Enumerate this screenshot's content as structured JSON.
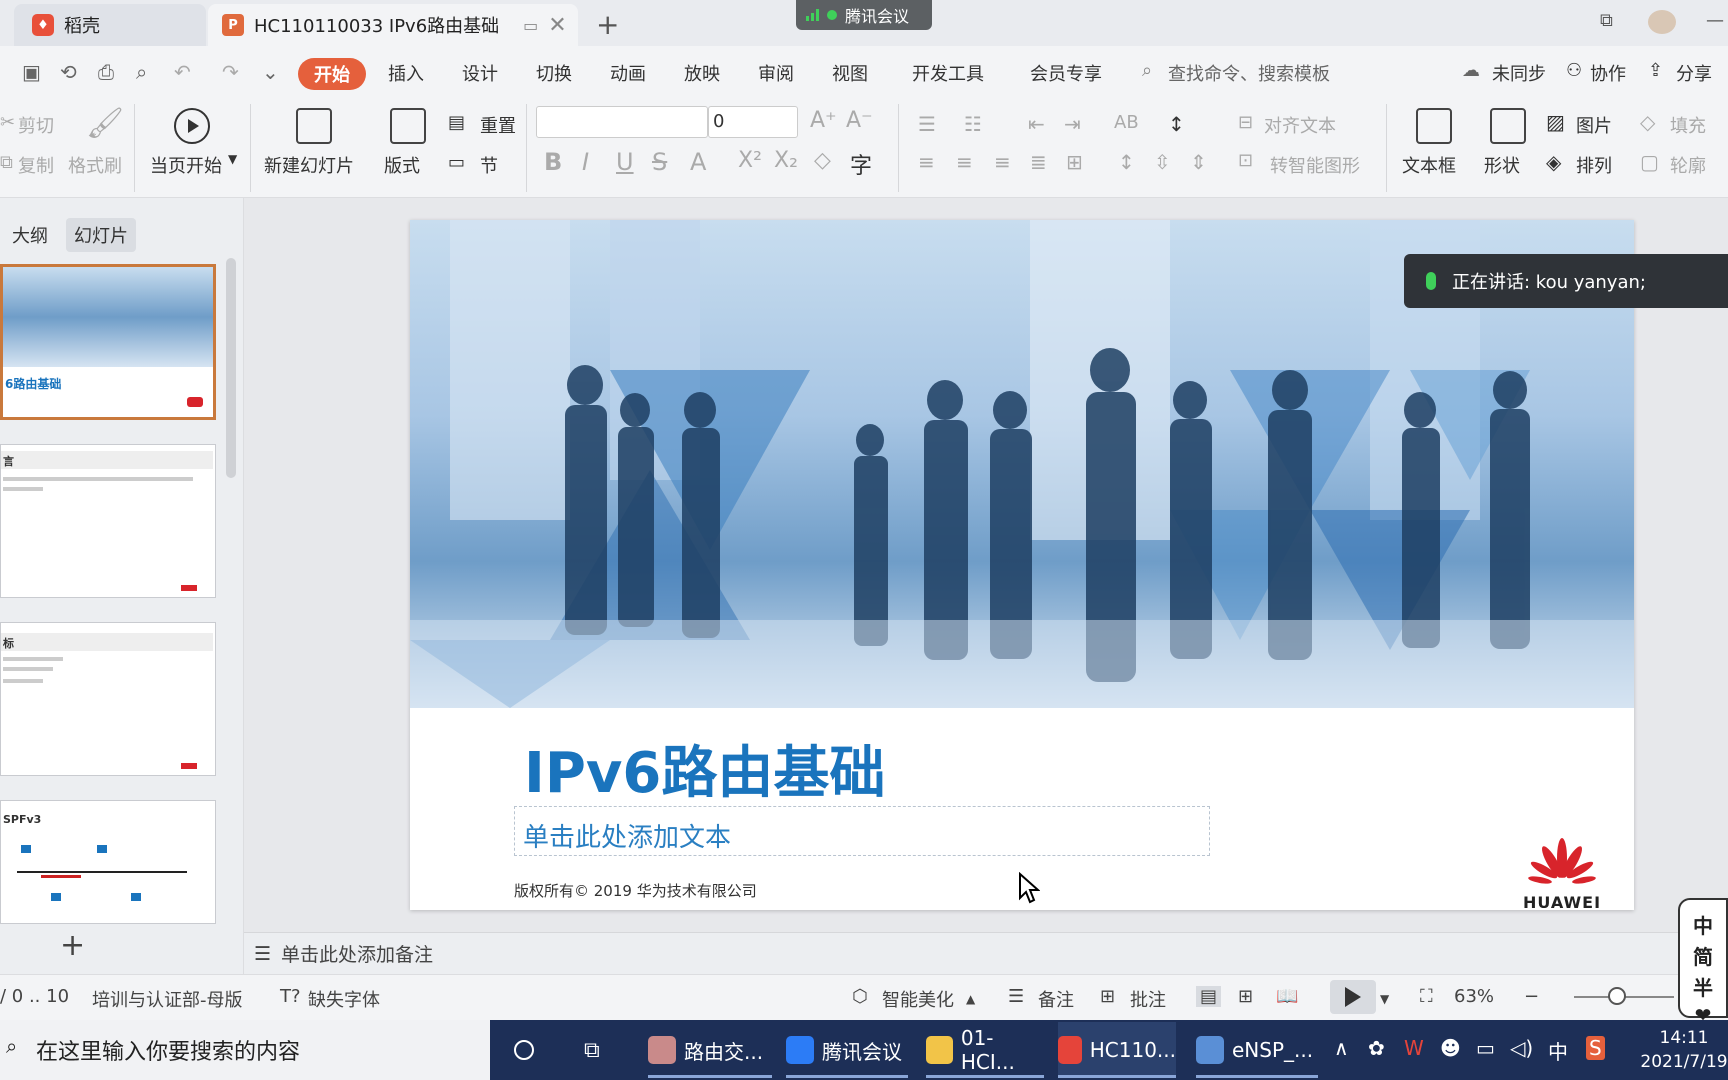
{
  "titlebar": {
    "tab_home": "稻壳",
    "tab_doc": "HC110110033 IPv6路由基础",
    "meeting_label": "腾讯会议"
  },
  "menu": {
    "items": [
      "开始",
      "插入",
      "设计",
      "切换",
      "动画",
      "放映",
      "审阅",
      "视图",
      "开发工具",
      "会员专享"
    ],
    "search_placeholder": "查找命令、搜索模板",
    "sync": "未同步",
    "collab": "协作",
    "share": "分享"
  },
  "ribbon": {
    "cut": "剪切",
    "copy": "复制",
    "format_painter": "格式刷",
    "play_from_current": "当页开始",
    "new_slide": "新建幻灯片",
    "layout": "版式",
    "reset": "重置",
    "section": "节",
    "font_size": "0",
    "align_text": "对齐文本",
    "smart_shape": "转智能图形",
    "textbox": "文本框",
    "shape": "形状",
    "picture": "图片",
    "arrange": "排列",
    "fill": "填充",
    "outline": "轮廓"
  },
  "left_panel": {
    "tab_outline": "大纲",
    "tab_slides": "幻灯片",
    "thumbs": [
      {
        "title": "6路由基础"
      },
      {
        "title": "言"
      },
      {
        "title": "标"
      },
      {
        "title": "SPFv3"
      }
    ]
  },
  "slide": {
    "title": "IPv6路由基础",
    "subtitle_placeholder": "单击此处添加文本",
    "copyright": "版权所有© 2019 华为技术有限公司",
    "brand": "HUAWEI"
  },
  "speaker": {
    "label": "正在讲话: kou yanyan;"
  },
  "notes": {
    "placeholder": "单击此处添加备注"
  },
  "statusbar": {
    "page": "/ 0 .. 10",
    "template": "培训与认证部-母版",
    "missing_font": "缺失字体",
    "beautify": "智能美化",
    "notes": "备注",
    "comments": "批注",
    "zoom": "63%"
  },
  "ime": {
    "chars": [
      "中",
      "简",
      "半"
    ]
  },
  "taskbar": {
    "search_placeholder": "在这里输入你要搜索的内容",
    "apps": [
      "路由交...",
      "腾讯会议",
      "01-HCI...",
      "HC110...",
      "eNSP_..."
    ],
    "ime_char": "中",
    "time": "14:11",
    "date": "2021/7/19"
  },
  "colors": {
    "accent": "#e5603c",
    "slide_title": "#1a74bd",
    "taskbar": "#1d2f57"
  }
}
